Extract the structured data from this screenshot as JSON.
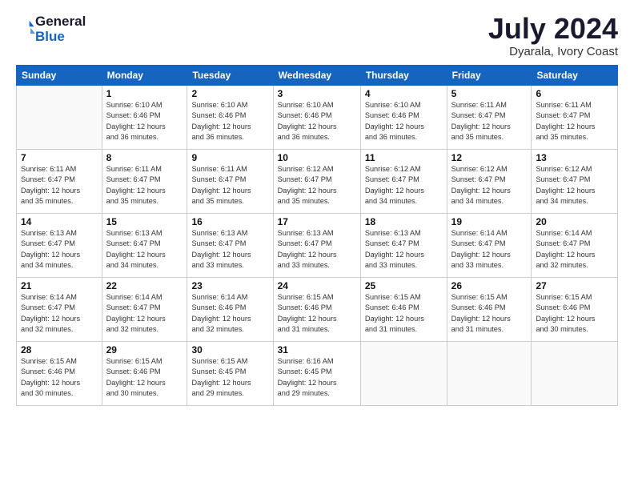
{
  "header": {
    "logo_line1": "General",
    "logo_line2": "Blue",
    "month": "July 2024",
    "location": "Dyarala, Ivory Coast"
  },
  "weekdays": [
    "Sunday",
    "Monday",
    "Tuesday",
    "Wednesday",
    "Thursday",
    "Friday",
    "Saturday"
  ],
  "weeks": [
    [
      {
        "day": "",
        "info": ""
      },
      {
        "day": "1",
        "info": "Sunrise: 6:10 AM\nSunset: 6:46 PM\nDaylight: 12 hours\nand 36 minutes."
      },
      {
        "day": "2",
        "info": "Sunrise: 6:10 AM\nSunset: 6:46 PM\nDaylight: 12 hours\nand 36 minutes."
      },
      {
        "day": "3",
        "info": "Sunrise: 6:10 AM\nSunset: 6:46 PM\nDaylight: 12 hours\nand 36 minutes."
      },
      {
        "day": "4",
        "info": "Sunrise: 6:10 AM\nSunset: 6:46 PM\nDaylight: 12 hours\nand 36 minutes."
      },
      {
        "day": "5",
        "info": "Sunrise: 6:11 AM\nSunset: 6:47 PM\nDaylight: 12 hours\nand 35 minutes."
      },
      {
        "day": "6",
        "info": "Sunrise: 6:11 AM\nSunset: 6:47 PM\nDaylight: 12 hours\nand 35 minutes."
      }
    ],
    [
      {
        "day": "7",
        "info": "Sunrise: 6:11 AM\nSunset: 6:47 PM\nDaylight: 12 hours\nand 35 minutes."
      },
      {
        "day": "8",
        "info": "Sunrise: 6:11 AM\nSunset: 6:47 PM\nDaylight: 12 hours\nand 35 minutes."
      },
      {
        "day": "9",
        "info": "Sunrise: 6:11 AM\nSunset: 6:47 PM\nDaylight: 12 hours\nand 35 minutes."
      },
      {
        "day": "10",
        "info": "Sunrise: 6:12 AM\nSunset: 6:47 PM\nDaylight: 12 hours\nand 35 minutes."
      },
      {
        "day": "11",
        "info": "Sunrise: 6:12 AM\nSunset: 6:47 PM\nDaylight: 12 hours\nand 34 minutes."
      },
      {
        "day": "12",
        "info": "Sunrise: 6:12 AM\nSunset: 6:47 PM\nDaylight: 12 hours\nand 34 minutes."
      },
      {
        "day": "13",
        "info": "Sunrise: 6:12 AM\nSunset: 6:47 PM\nDaylight: 12 hours\nand 34 minutes."
      }
    ],
    [
      {
        "day": "14",
        "info": "Sunrise: 6:13 AM\nSunset: 6:47 PM\nDaylight: 12 hours\nand 34 minutes."
      },
      {
        "day": "15",
        "info": "Sunrise: 6:13 AM\nSunset: 6:47 PM\nDaylight: 12 hours\nand 34 minutes."
      },
      {
        "day": "16",
        "info": "Sunrise: 6:13 AM\nSunset: 6:47 PM\nDaylight: 12 hours\nand 33 minutes."
      },
      {
        "day": "17",
        "info": "Sunrise: 6:13 AM\nSunset: 6:47 PM\nDaylight: 12 hours\nand 33 minutes."
      },
      {
        "day": "18",
        "info": "Sunrise: 6:13 AM\nSunset: 6:47 PM\nDaylight: 12 hours\nand 33 minutes."
      },
      {
        "day": "19",
        "info": "Sunrise: 6:14 AM\nSunset: 6:47 PM\nDaylight: 12 hours\nand 33 minutes."
      },
      {
        "day": "20",
        "info": "Sunrise: 6:14 AM\nSunset: 6:47 PM\nDaylight: 12 hours\nand 32 minutes."
      }
    ],
    [
      {
        "day": "21",
        "info": "Sunrise: 6:14 AM\nSunset: 6:47 PM\nDaylight: 12 hours\nand 32 minutes."
      },
      {
        "day": "22",
        "info": "Sunrise: 6:14 AM\nSunset: 6:47 PM\nDaylight: 12 hours\nand 32 minutes."
      },
      {
        "day": "23",
        "info": "Sunrise: 6:14 AM\nSunset: 6:46 PM\nDaylight: 12 hours\nand 32 minutes."
      },
      {
        "day": "24",
        "info": "Sunrise: 6:15 AM\nSunset: 6:46 PM\nDaylight: 12 hours\nand 31 minutes."
      },
      {
        "day": "25",
        "info": "Sunrise: 6:15 AM\nSunset: 6:46 PM\nDaylight: 12 hours\nand 31 minutes."
      },
      {
        "day": "26",
        "info": "Sunrise: 6:15 AM\nSunset: 6:46 PM\nDaylight: 12 hours\nand 31 minutes."
      },
      {
        "day": "27",
        "info": "Sunrise: 6:15 AM\nSunset: 6:46 PM\nDaylight: 12 hours\nand 30 minutes."
      }
    ],
    [
      {
        "day": "28",
        "info": "Sunrise: 6:15 AM\nSunset: 6:46 PM\nDaylight: 12 hours\nand 30 minutes."
      },
      {
        "day": "29",
        "info": "Sunrise: 6:15 AM\nSunset: 6:46 PM\nDaylight: 12 hours\nand 30 minutes."
      },
      {
        "day": "30",
        "info": "Sunrise: 6:15 AM\nSunset: 6:45 PM\nDaylight: 12 hours\nand 29 minutes."
      },
      {
        "day": "31",
        "info": "Sunrise: 6:16 AM\nSunset: 6:45 PM\nDaylight: 12 hours\nand 29 minutes."
      },
      {
        "day": "",
        "info": ""
      },
      {
        "day": "",
        "info": ""
      },
      {
        "day": "",
        "info": ""
      }
    ]
  ]
}
